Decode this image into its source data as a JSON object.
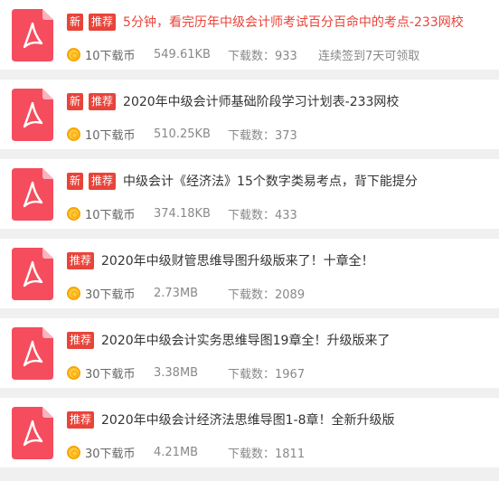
{
  "colors": {
    "accent": "#e8443a",
    "icon": "#f54d5e",
    "coin": "#ffc83a"
  },
  "labels": {
    "new_badge": "新",
    "hot_badge": "推荐",
    "downloads_prefix": "下载数："
  },
  "items": [
    {
      "badges": [
        "新",
        "推荐"
      ],
      "title": "5分钟，看完历年中级会计师考试百分百命中的考点-233网校",
      "title_highlighted": true,
      "cost": "10下载币",
      "size": "549.61KB",
      "downloads": "下载数：933",
      "note": "连续签到7天可领取"
    },
    {
      "badges": [
        "新",
        "推荐"
      ],
      "title": "2020年中级会计师基础阶段学习计划表-233网校",
      "cost": "10下载币",
      "size": "510.25KB",
      "downloads": "下载数：373"
    },
    {
      "badges": [
        "新",
        "推荐"
      ],
      "title": "中级会计《经济法》15个数字类易考点，背下能提分",
      "cost": "10下载币",
      "size": "374.18KB",
      "downloads": "下载数：433"
    },
    {
      "badges": [
        "推荐"
      ],
      "title": "2020年中级财管思维导图升级版来了！十章全！",
      "cost": "30下载币",
      "size": "2.73MB",
      "downloads": "下载数：2089"
    },
    {
      "badges": [
        "推荐"
      ],
      "title": "2020年中级会计实务思维导图19章全！升级版来了",
      "cost": "30下载币",
      "size": "3.38MB",
      "downloads": "下载数：1967"
    },
    {
      "badges": [
        "推荐"
      ],
      "title": "2020年中级会计经济法思维导图1-8章！全新升级版",
      "cost": "30下载币",
      "size": "4.21MB",
      "downloads": "下载数：1811"
    }
  ]
}
